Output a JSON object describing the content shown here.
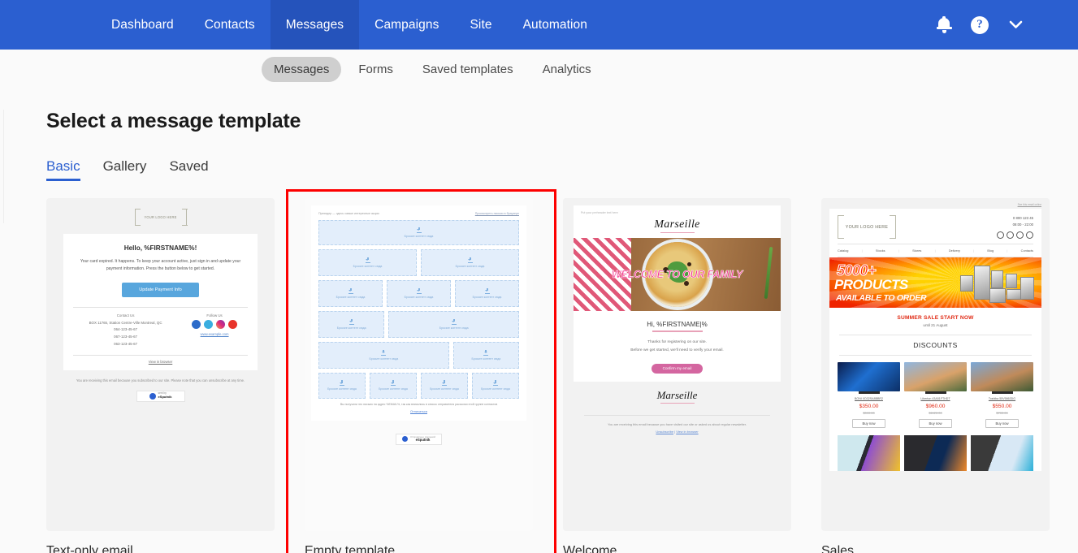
{
  "topnav": {
    "items": [
      {
        "label": "Dashboard",
        "active": false
      },
      {
        "label": "Contacts",
        "active": false
      },
      {
        "label": "Messages",
        "active": true
      },
      {
        "label": "Campaigns",
        "active": false
      },
      {
        "label": "Site",
        "active": false
      },
      {
        "label": "Automation",
        "active": false
      }
    ],
    "icons": {
      "notifications": "bell-icon",
      "help": "?",
      "account_caret": "chevron-down-icon"
    },
    "accent_color": "#2b5fd0",
    "active_color": "#2553bb"
  },
  "subnav": {
    "items": [
      {
        "label": "Messages",
        "active": true
      },
      {
        "label": "Forms",
        "active": false
      },
      {
        "label": "Saved templates",
        "active": false
      },
      {
        "label": "Analytics",
        "active": false
      }
    ]
  },
  "page": {
    "title": "Select a message template",
    "filter_tabs": [
      {
        "label": "Basic",
        "active": true
      },
      {
        "label": "Gallery",
        "active": false
      },
      {
        "label": "Saved",
        "active": false
      }
    ],
    "selected_template": "Empty template",
    "selection_outline_color": "#fd0000"
  },
  "templates": [
    {
      "name": "Text-only email",
      "selected": false,
      "preview": {
        "logo_placeholder": "YOUR LOGO HERE",
        "heading": "Hello, %FIRSTNAME%!",
        "body": "Your card expired. It happens. To keep your account active, just sign in and update your payment information. Press the button below to get started.",
        "button": "Update Payment Info",
        "contact_heading": "Contact Us",
        "address": "BOX 11765, Station Centre-Ville Montreal, QC",
        "phones": [
          "064-123-45-67",
          "067-123-45-67",
          "063-123-45-67"
        ],
        "follow_heading": "Follow Us",
        "social": [
          "facebook-icon",
          "twitter-icon",
          "instagram-icon",
          "youtube-icon"
        ],
        "website": "www.example.com",
        "view_in_browser": "View in browser",
        "footer": "You are receiving this email because you subscribed to our site. Please note that you can unsubscribe at any time.",
        "footer_link": "unsubscribe",
        "badge_small": "sent by",
        "badge_brand": "eSputnik"
      }
    },
    {
      "name": "Empty template",
      "selected": true,
      "preview": {
        "preheader": "Прехедер — здесь самые интересные акции",
        "browser_link": "Просмотреть письмо в браузере",
        "drop_text": "Бросьте контент сюда",
        "rows": [
          {
            "cols": [
              1
            ]
          },
          {
            "cols": [
              1,
              1
            ]
          },
          {
            "cols": [
              1,
              1,
              1
            ]
          },
          {
            "cols": [
              1,
              2
            ]
          },
          {
            "cols": [
              2,
              1
            ]
          },
          {
            "cols": [
              1,
              1,
              1,
              1
            ]
          }
        ],
        "footer": "Вы получили это письмо на адрес %EMAIL%, так как вписались в список отправителя рассылки этой группе контактов",
        "unsubscribe": "Отписаться",
        "badge_small": "Отправлено системой",
        "badge_brand": "eSputnik"
      }
    },
    {
      "name": "Welcome",
      "selected": false,
      "preview": {
        "preheader": "Put your preheader text here",
        "brand": "Marseille",
        "hero_text": "WELCOME TO OUR FAMILY",
        "greeting": "Hi, %FIRSTNAME|%",
        "body_line1": "Thanks for registering on our site.",
        "body_line2": "Before we get started, we'll need to verify your email.",
        "button": "Confirm my email",
        "brand_footer": "Marseille",
        "footer": "You are receiving this email because you have visited our site or asked us about regular newsletter.",
        "links": [
          "Unsubscribe",
          "View in browser"
        ],
        "links_separator": "|"
      }
    },
    {
      "name": "Sales",
      "selected": false,
      "preview": {
        "see_online": "See this email online",
        "logo_placeholder": "YOUR LOGO HERE",
        "phone": "0 800 123 45",
        "hours": "08:00 - 22:00",
        "social": [
          "facebook-icon",
          "twitter-icon",
          "instagram-icon",
          "youtube-icon"
        ],
        "menu": [
          "Catalog",
          "Stocks",
          "Stores",
          "Delivery",
          "Blog",
          "Contacts"
        ],
        "banner_line1": "5000+",
        "banner_line2": "PRODUCTS",
        "banner_line3": "AVAILABLE TO ORDER",
        "sale_heading": "SUMMER SALE START NOW",
        "sale_until": "until 21 August",
        "discounts_heading": "DISCOUNTS",
        "products": [
          {
            "name": "BONI XD32SA8BBR2",
            "price": "$350.00",
            "old_price": "$590.00",
            "button": "Buy now"
          },
          {
            "name": "Liberton 43A51FTHDT",
            "price": "$960.00",
            "old_price": "$1120.00",
            "button": "Buy now"
          },
          {
            "name": "Toshiba 55V5863DG",
            "price": "$550.00",
            "old_price": "$700.00",
            "button": "Buy now"
          }
        ],
        "phones_row": [
          "phone-image-1",
          "phone-image-2",
          "phone-image-3"
        ]
      }
    }
  ]
}
